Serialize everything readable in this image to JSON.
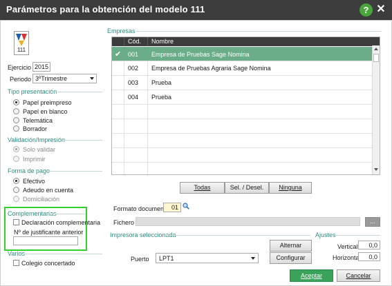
{
  "window": {
    "title": "Parámetros para la obtención del modelo 111",
    "help_glyph": "?",
    "close_glyph": "✕"
  },
  "logo": {
    "label": "111",
    "icon": "model-111-logo-icon"
  },
  "left": {
    "ejercicio_label": "Ejercicio",
    "ejercicio_value": "2015",
    "periodo_label": "Periodo",
    "periodo_value": "3ºTrimestre",
    "tipo_presentacion": {
      "title": "Tipo presentación",
      "options": [
        "Papel preimpreso",
        "Papel en blanco",
        "Telemática",
        "Borrador"
      ],
      "selected": 0
    },
    "validacion": {
      "title": "Validación/Impresión",
      "options": [
        "Solo validar",
        "Imprimir"
      ],
      "selected": 0
    },
    "forma_pago": {
      "title": "Forma de pago",
      "options": [
        "Efectivo",
        "Adeudo en cuenta",
        "Domiciliación"
      ],
      "selected": 0
    },
    "complementarias": {
      "title": "Complementarias",
      "check_label": "Declaración complementaria",
      "checked": false,
      "justificante_label": "Nº de justificante anterior",
      "justificante_value": ""
    },
    "varios": {
      "title": "Varios",
      "check_label": "Colegio concertado",
      "checked": false
    }
  },
  "empresas": {
    "title": "Empresas",
    "columns": [
      "Cód.",
      "Nombre"
    ],
    "rows": [
      {
        "cod": "001",
        "nombre": "Empresa de Pruebas Sage Nomina",
        "selected": true
      },
      {
        "cod": "002",
        "nombre": "Empresa de Pruebas Agraria Sage Nomina",
        "selected": false
      },
      {
        "cod": "003",
        "nombre": "Prueba",
        "selected": false
      },
      {
        "cod": "004",
        "nombre": "Prueba",
        "selected": false
      }
    ],
    "check_glyph": "✔",
    "buttons": [
      "Todas",
      "Sel. / Desel.",
      "Ninguna"
    ]
  },
  "formato": {
    "label": "Formato documento",
    "value": "01",
    "fichero_label": "Fichero",
    "fichero_value": "",
    "browse_label": "..."
  },
  "impresora": {
    "title": "Impresora seleccionada",
    "alternar_label": "Alternar",
    "configurar_label": "Configurar",
    "puerto_label": "Puerto",
    "puerto_value": "LPT1"
  },
  "ajustes": {
    "title": "Ajustes",
    "vertical_label": "Vertical",
    "vertical_value": "0,0",
    "horizontal_label": "Horizontal",
    "horizontal_value": "0,0"
  },
  "footer": {
    "accept_label": "Aceptar",
    "cancel_label": "Cancelar"
  },
  "colors": {
    "title_bar": "#3c3c3c",
    "group_title": "#2e8c7f",
    "selected_row": "#6aad88",
    "accept_button": "#3aa35a",
    "highlight_box": "#33d12c"
  }
}
